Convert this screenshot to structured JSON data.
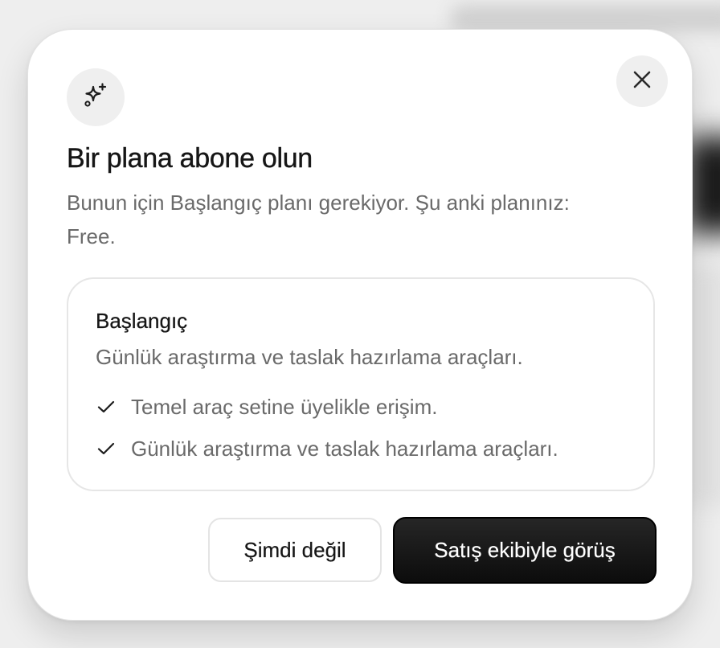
{
  "dialog": {
    "title": "Bir plana abone olun",
    "subtitle": "Bunun için Başlangıç planı gerekiyor. Şu anki planınız: Free.",
    "badge_icon": "sparkles-icon",
    "close_icon": "close-icon"
  },
  "plan": {
    "name": "Başlangıç",
    "description": "Günlük araştırma ve taslak hazırlama araçları.",
    "features": [
      "Temel araç setine üyelikle erişim.",
      "Günlük araştırma ve taslak hazırlama araçları."
    ],
    "feature_icon": "check-icon"
  },
  "actions": {
    "secondary_label": "Şimdi değil",
    "primary_label": "Satış ekibiyle görüş"
  },
  "colors": {
    "primary_button": "#161616",
    "muted_text": "#6a6a6a",
    "heading_text": "#161616",
    "icon_circle": "#efefef"
  }
}
